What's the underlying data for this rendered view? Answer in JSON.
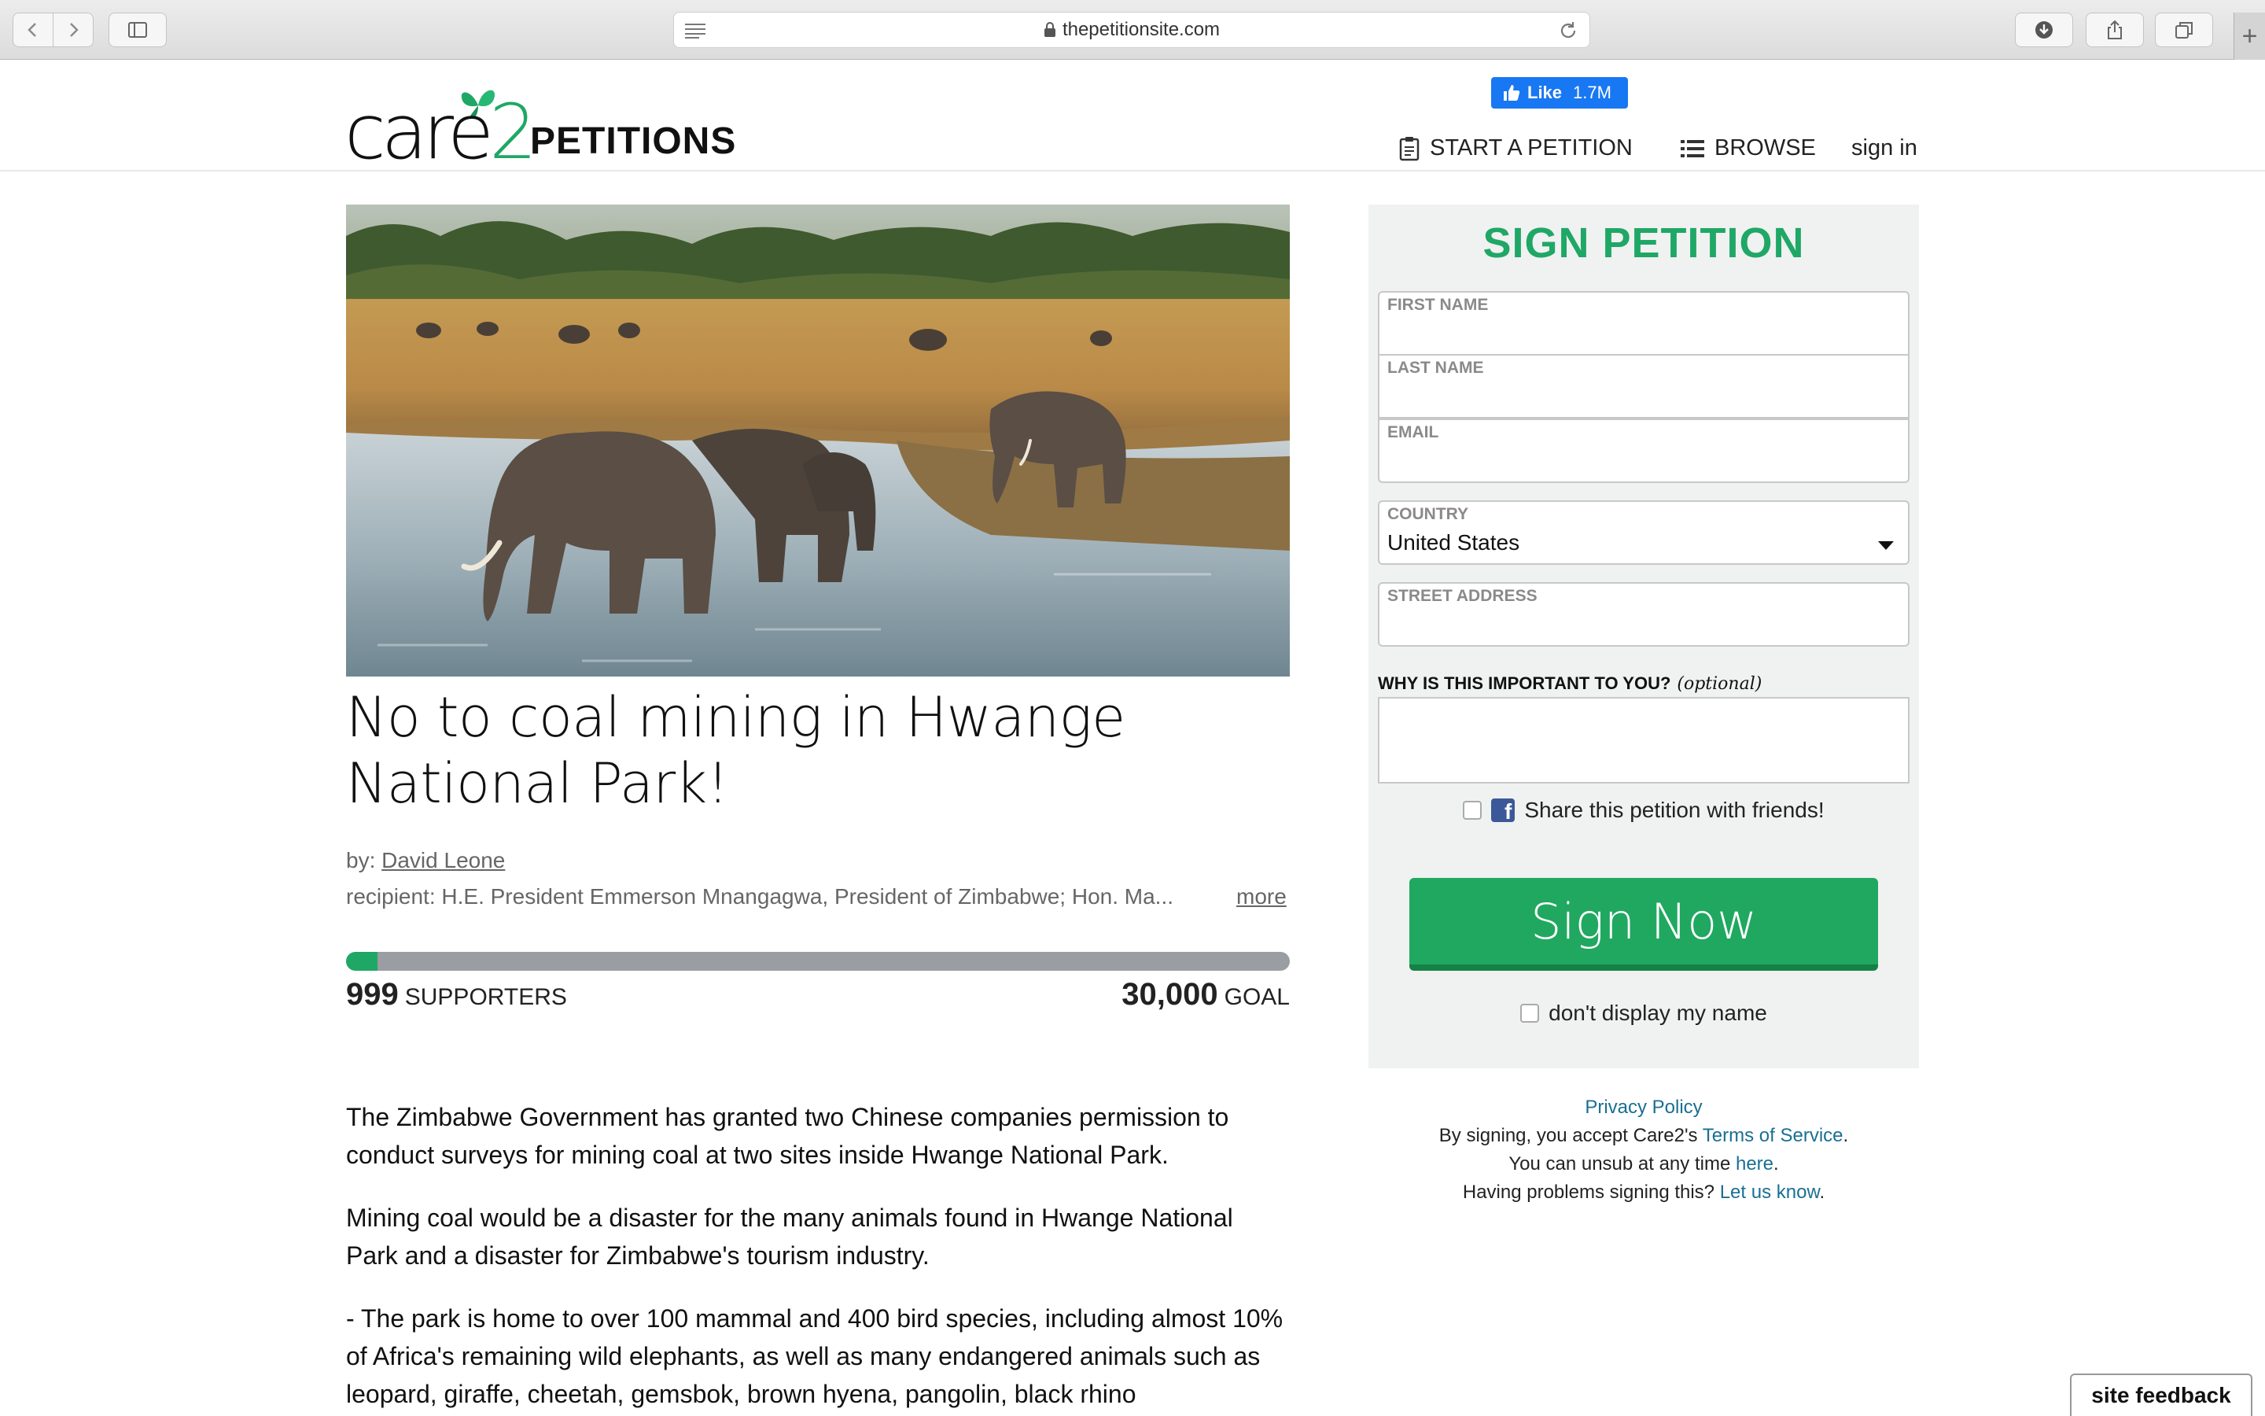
{
  "browser": {
    "url": "thepetitionsite.com"
  },
  "header": {
    "logo_care": "care",
    "logo_two": "2",
    "logo_petitions": "PETITIONS",
    "fb_like_label": "Like",
    "fb_like_count": "1.7M",
    "nav": {
      "start": "START A PETITION",
      "browse": "BROWSE",
      "signin": "sign in"
    }
  },
  "petition": {
    "title": "No to coal mining in Hwange National Park!",
    "by_label": "by:",
    "author": "David Leone",
    "recipient": "recipient: H.E. President Emmerson Mnangagwa, President of Zimbabwe; Hon. Ma...",
    "more": "more",
    "supporters_count": "999",
    "supporters_label": "SUPPORTERS",
    "goal_count": "30,000",
    "goal_label": "GOAL",
    "progress_fraction": 0.0333,
    "body": [
      "The Zimbabwe Government has granted two Chinese companies permission to conduct surveys for mining coal at two sites inside Hwange National Park.",
      "Mining coal would be a disaster for the many animals found in Hwange National Park and a disaster for Zimbabwe's tourism industry.",
      "- The park is home to over 100 mammal and 400 bird species, including almost 10% of Africa's remaining wild elephants, as well as many endangered animals such as leopard, giraffe, cheetah, gemsbok, brown hyena, pangolin, black rhino"
    ]
  },
  "sign": {
    "title": "SIGN PETITION",
    "first_name_label": "FIRST NAME",
    "last_name_label": "LAST NAME",
    "email_label": "EMAIL",
    "country_label": "COUNTRY",
    "country_value": "United States",
    "street_label": "STREET ADDRESS",
    "why_label": "WHY IS THIS IMPORTANT TO YOU?",
    "why_optional": "(optional)",
    "share_label": "Share this petition with friends!",
    "button": "Sign Now",
    "hide_name_label": "don't display my name"
  },
  "legal": {
    "privacy": "Privacy Policy",
    "accept_prefix": "By signing, you accept Care2's",
    "terms": "Terms of Service",
    "unsub_prefix": "You can unsub at any time",
    "here": "here",
    "problems_prefix": "Having problems signing this?",
    "let_us_know": "Let us know"
  },
  "feedback": "site feedback",
  "colors": {
    "brand_green": "#1fa766",
    "progress_track": "#9a9da1",
    "link": "#1a6f93",
    "facebook": "#1877f2"
  }
}
